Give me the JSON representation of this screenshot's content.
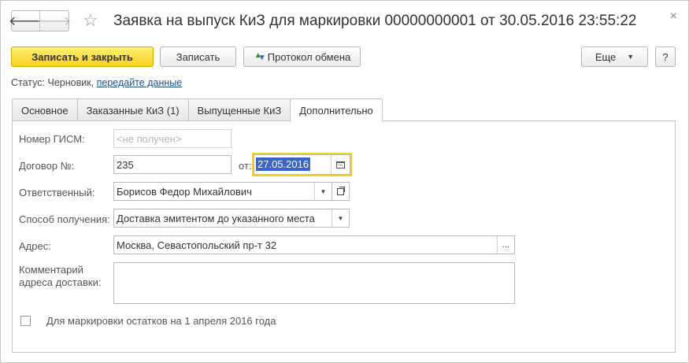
{
  "header": {
    "title": "Заявка на выпуск КиЗ для маркировки 00000000001 от 30.05.2016 23:55:22",
    "back_glyph": "🡐",
    "forward_glyph": "🡒",
    "star_glyph": "☆",
    "close_glyph": "×"
  },
  "toolbar": {
    "save_close_label": "Записать и закрыть",
    "save_label": "Записать",
    "protocol_label": "Протокол обмена",
    "more_label": "Еще",
    "help_label": "?"
  },
  "status": {
    "label": "Статус:",
    "value": "Черновик,",
    "link": "передайте данные"
  },
  "tabs": [
    {
      "label": "Основное",
      "active": false
    },
    {
      "label": "Заказанные КиЗ (1)",
      "active": false
    },
    {
      "label": "Выпущенные КиЗ",
      "active": false
    },
    {
      "label": "Дополнительно",
      "active": true
    }
  ],
  "form": {
    "gism_label": "Номер ГИСМ:",
    "gism_placeholder": "<не получен>",
    "contract_label": "Договор №:",
    "contract_value": "235",
    "from_label": "от:",
    "date_value": "27.05.2016",
    "responsible_label": "Ответственный:",
    "responsible_value": "Борисов Федор Михайлович",
    "method_label": "Способ получения:",
    "method_value": "Доставка эмитентом до указанного места",
    "address_label": "Адрес:",
    "address_value": "Москва, Севастопольский пр-т 32",
    "address_btn": "...",
    "comment_label_1": "Комментарий",
    "comment_label_2": "адреса доставки:",
    "comment_value": "",
    "checkbox_label": "Для маркировки остатков на 1 апреля 2016 года",
    "checkbox_checked": false
  },
  "colors": {
    "primary_button": "#f7d31c",
    "focus_border": "#f3d321",
    "selection": "#3a64c8",
    "link": "#1a4f8c"
  }
}
